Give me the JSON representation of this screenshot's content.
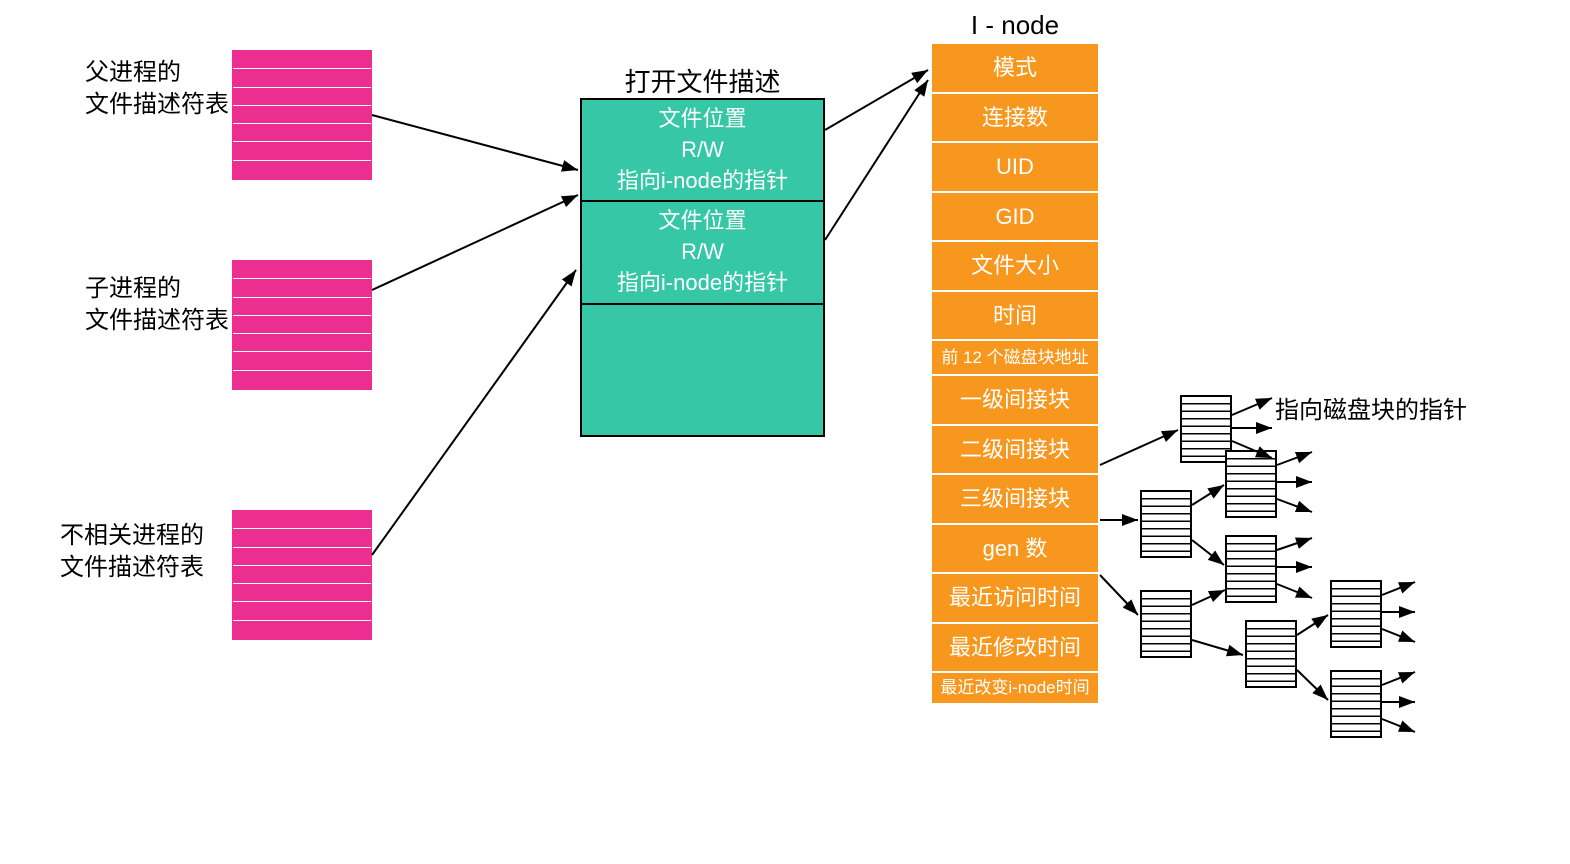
{
  "fd_tables": [
    {
      "label_l1": "父进程的",
      "label_l2": "文件描述符表"
    },
    {
      "label_l1": "子进程的",
      "label_l2": "文件描述符表"
    },
    {
      "label_l1": "不相关进程的",
      "label_l2": "文件描述符表"
    }
  ],
  "ofd": {
    "title": "打开文件描述",
    "row1_l1": "文件位置",
    "row1_l2": "R/W",
    "row1_l3": "指向i-node的指针",
    "row2_l1": "文件位置",
    "row2_l2": "R/W",
    "row2_l3": "指向i-node的指针"
  },
  "inode": {
    "title": "I - node",
    "cells": [
      "模式",
      "连接数",
      "UID",
      "GID",
      "文件大小",
      "时间",
      "前 12 个磁盘块地址",
      "一级间接块",
      "二级间接块",
      "三级间接块",
      "gen 数",
      "最近访问时间",
      "最近修改时间",
      "最近改变i-node时间"
    ]
  },
  "pointer_label": "指向磁盘块的指针"
}
